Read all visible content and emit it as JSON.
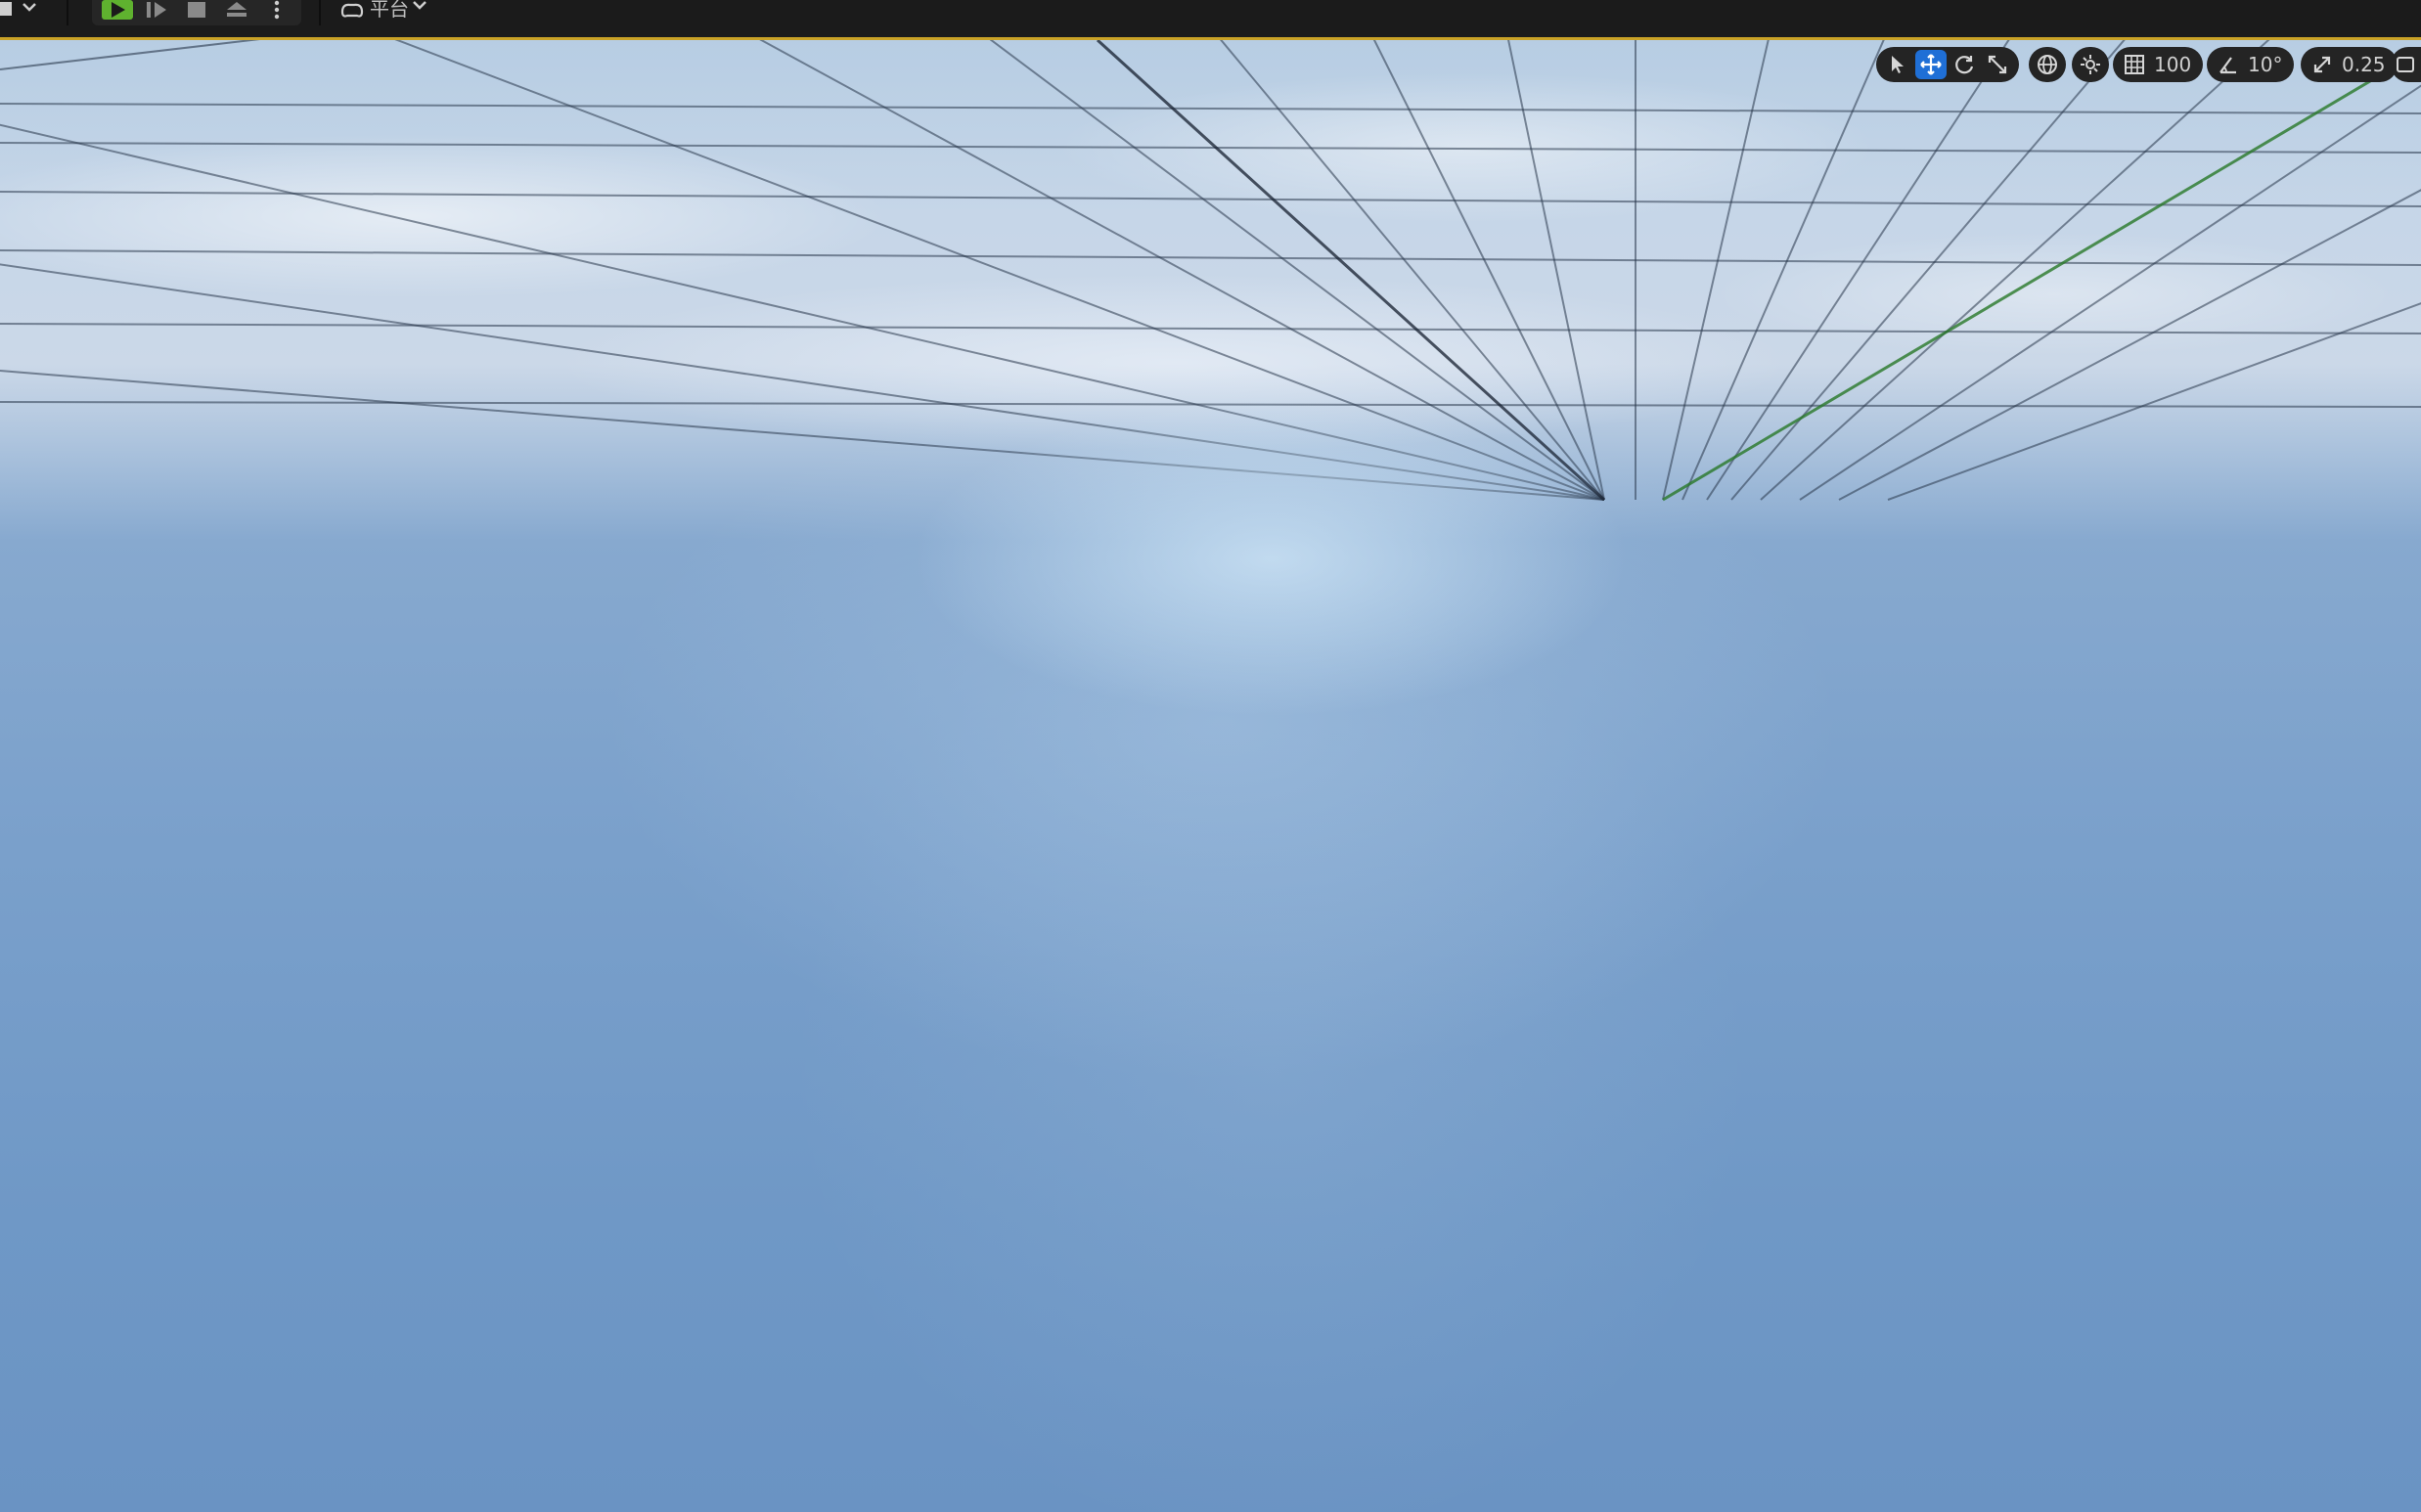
{
  "toolbar": {
    "platforms_label": "平台",
    "icons": [
      "menu-icon",
      "chevron-down-icon",
      "play-icon",
      "advance-frame-icon",
      "stop-icon",
      "eject-icon",
      "more-options-icon",
      "gamepad-icon",
      "chevron-down-icon"
    ]
  },
  "viewport_toolbar": {
    "transform_tools": [
      "select-icon",
      "translate-icon",
      "rotate-icon",
      "scale-icon"
    ],
    "active_tool": "translate-icon",
    "grid_snap_value": "100",
    "rotation_snap_value": "10°",
    "scale_snap_value": "0.25"
  },
  "colors": {
    "accent": "#1f6fd6",
    "highlight_border": "#c9a227",
    "play_green": "#5fb22f"
  }
}
